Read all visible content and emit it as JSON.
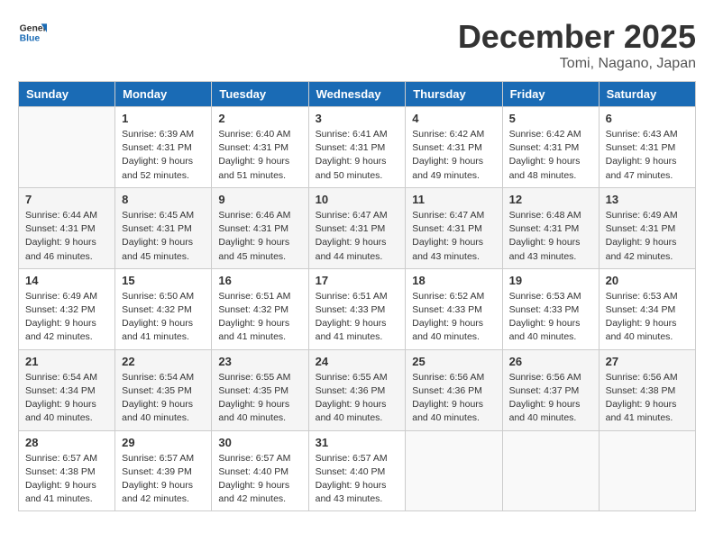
{
  "logo": {
    "general": "General",
    "blue": "Blue"
  },
  "title": "December 2025",
  "location": "Tomi, Nagano, Japan",
  "days_header": [
    "Sunday",
    "Monday",
    "Tuesday",
    "Wednesday",
    "Thursday",
    "Friday",
    "Saturday"
  ],
  "weeks": [
    [
      {
        "num": "",
        "detail": ""
      },
      {
        "num": "1",
        "detail": "Sunrise: 6:39 AM\nSunset: 4:31 PM\nDaylight: 9 hours\nand 52 minutes."
      },
      {
        "num": "2",
        "detail": "Sunrise: 6:40 AM\nSunset: 4:31 PM\nDaylight: 9 hours\nand 51 minutes."
      },
      {
        "num": "3",
        "detail": "Sunrise: 6:41 AM\nSunset: 4:31 PM\nDaylight: 9 hours\nand 50 minutes."
      },
      {
        "num": "4",
        "detail": "Sunrise: 6:42 AM\nSunset: 4:31 PM\nDaylight: 9 hours\nand 49 minutes."
      },
      {
        "num": "5",
        "detail": "Sunrise: 6:42 AM\nSunset: 4:31 PM\nDaylight: 9 hours\nand 48 minutes."
      },
      {
        "num": "6",
        "detail": "Sunrise: 6:43 AM\nSunset: 4:31 PM\nDaylight: 9 hours\nand 47 minutes."
      }
    ],
    [
      {
        "num": "7",
        "detail": "Sunrise: 6:44 AM\nSunset: 4:31 PM\nDaylight: 9 hours\nand 46 minutes."
      },
      {
        "num": "8",
        "detail": "Sunrise: 6:45 AM\nSunset: 4:31 PM\nDaylight: 9 hours\nand 45 minutes."
      },
      {
        "num": "9",
        "detail": "Sunrise: 6:46 AM\nSunset: 4:31 PM\nDaylight: 9 hours\nand 45 minutes."
      },
      {
        "num": "10",
        "detail": "Sunrise: 6:47 AM\nSunset: 4:31 PM\nDaylight: 9 hours\nand 44 minutes."
      },
      {
        "num": "11",
        "detail": "Sunrise: 6:47 AM\nSunset: 4:31 PM\nDaylight: 9 hours\nand 43 minutes."
      },
      {
        "num": "12",
        "detail": "Sunrise: 6:48 AM\nSunset: 4:31 PM\nDaylight: 9 hours\nand 43 minutes."
      },
      {
        "num": "13",
        "detail": "Sunrise: 6:49 AM\nSunset: 4:31 PM\nDaylight: 9 hours\nand 42 minutes."
      }
    ],
    [
      {
        "num": "14",
        "detail": "Sunrise: 6:49 AM\nSunset: 4:32 PM\nDaylight: 9 hours\nand 42 minutes."
      },
      {
        "num": "15",
        "detail": "Sunrise: 6:50 AM\nSunset: 4:32 PM\nDaylight: 9 hours\nand 41 minutes."
      },
      {
        "num": "16",
        "detail": "Sunrise: 6:51 AM\nSunset: 4:32 PM\nDaylight: 9 hours\nand 41 minutes."
      },
      {
        "num": "17",
        "detail": "Sunrise: 6:51 AM\nSunset: 4:33 PM\nDaylight: 9 hours\nand 41 minutes."
      },
      {
        "num": "18",
        "detail": "Sunrise: 6:52 AM\nSunset: 4:33 PM\nDaylight: 9 hours\nand 40 minutes."
      },
      {
        "num": "19",
        "detail": "Sunrise: 6:53 AM\nSunset: 4:33 PM\nDaylight: 9 hours\nand 40 minutes."
      },
      {
        "num": "20",
        "detail": "Sunrise: 6:53 AM\nSunset: 4:34 PM\nDaylight: 9 hours\nand 40 minutes."
      }
    ],
    [
      {
        "num": "21",
        "detail": "Sunrise: 6:54 AM\nSunset: 4:34 PM\nDaylight: 9 hours\nand 40 minutes."
      },
      {
        "num": "22",
        "detail": "Sunrise: 6:54 AM\nSunset: 4:35 PM\nDaylight: 9 hours\nand 40 minutes."
      },
      {
        "num": "23",
        "detail": "Sunrise: 6:55 AM\nSunset: 4:35 PM\nDaylight: 9 hours\nand 40 minutes."
      },
      {
        "num": "24",
        "detail": "Sunrise: 6:55 AM\nSunset: 4:36 PM\nDaylight: 9 hours\nand 40 minutes."
      },
      {
        "num": "25",
        "detail": "Sunrise: 6:56 AM\nSunset: 4:36 PM\nDaylight: 9 hours\nand 40 minutes."
      },
      {
        "num": "26",
        "detail": "Sunrise: 6:56 AM\nSunset: 4:37 PM\nDaylight: 9 hours\nand 40 minutes."
      },
      {
        "num": "27",
        "detail": "Sunrise: 6:56 AM\nSunset: 4:38 PM\nDaylight: 9 hours\nand 41 minutes."
      }
    ],
    [
      {
        "num": "28",
        "detail": "Sunrise: 6:57 AM\nSunset: 4:38 PM\nDaylight: 9 hours\nand 41 minutes."
      },
      {
        "num": "29",
        "detail": "Sunrise: 6:57 AM\nSunset: 4:39 PM\nDaylight: 9 hours\nand 42 minutes."
      },
      {
        "num": "30",
        "detail": "Sunrise: 6:57 AM\nSunset: 4:40 PM\nDaylight: 9 hours\nand 42 minutes."
      },
      {
        "num": "31",
        "detail": "Sunrise: 6:57 AM\nSunset: 4:40 PM\nDaylight: 9 hours\nand 43 minutes."
      },
      {
        "num": "",
        "detail": ""
      },
      {
        "num": "",
        "detail": ""
      },
      {
        "num": "",
        "detail": ""
      }
    ]
  ]
}
